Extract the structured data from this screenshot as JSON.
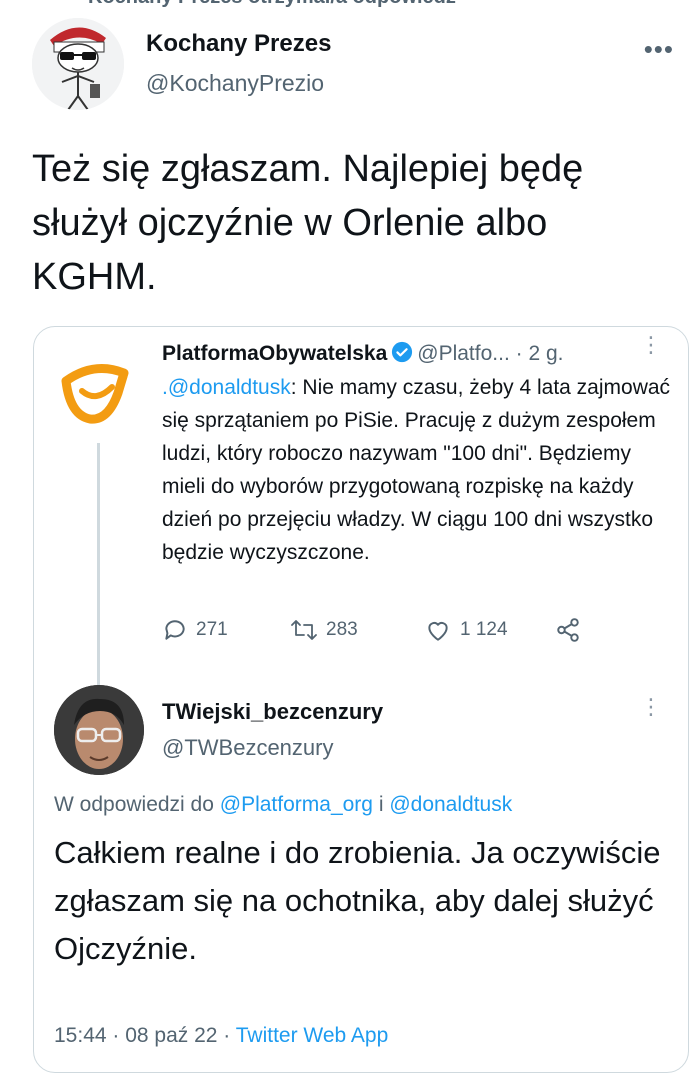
{
  "retweet_banner": {
    "text": "Kochany Prezes otrzymał/a odpowiedź"
  },
  "tweet": {
    "author_name": "Kochany Prezes",
    "author_handle": "@KochanyPrezio",
    "more": "•••",
    "text": "Też się zgłaszam.  Najlepiej będę służył ojczyźnie w Orlenie albo KGHM."
  },
  "quoted": {
    "author_name": "PlatformaObywatelska",
    "author_handle": "@Platfo...",
    "time": "· 2 g.",
    "more": "⋮",
    "mention": ".@donaldtusk",
    "text": ": Nie mamy czasu, żeby 4 lata zajmować się sprzątaniem po PiSie. Pracuję z dużym zespołem ludzi, który roboczo nazywam \"100 dni\". Będziemy mieli do wyborów przygotowaną rozpiskę na każdy dzień po przejęciu władzy. W ciągu 100 dni wszystko będzie wyczyszczone.",
    "replies": "271",
    "retweets": "283",
    "likes": "1 124",
    "brand_color": "#f39c12"
  },
  "reply": {
    "author_name": "TWiejski_bezcenzury",
    "author_handle": "@TWBezcenzury",
    "more": "⋮",
    "reply_prefix": "W odpowiedzi do ",
    "reply_mention_1": "@Platforma_org",
    "reply_and": " i ",
    "reply_mention_2": "@donaldtusk",
    "text": "Całkiem realne i do zrobienia. Ja oczywiście zgłaszam się na ochotnika, aby dalej służyć Ojczyźnie.",
    "timestamp": "15:44 · 08 paź 22 · ",
    "app": "Twitter Web App"
  },
  "colors": {
    "link": "#1d9bf0",
    "muted": "#536471",
    "text": "#0f1419"
  }
}
